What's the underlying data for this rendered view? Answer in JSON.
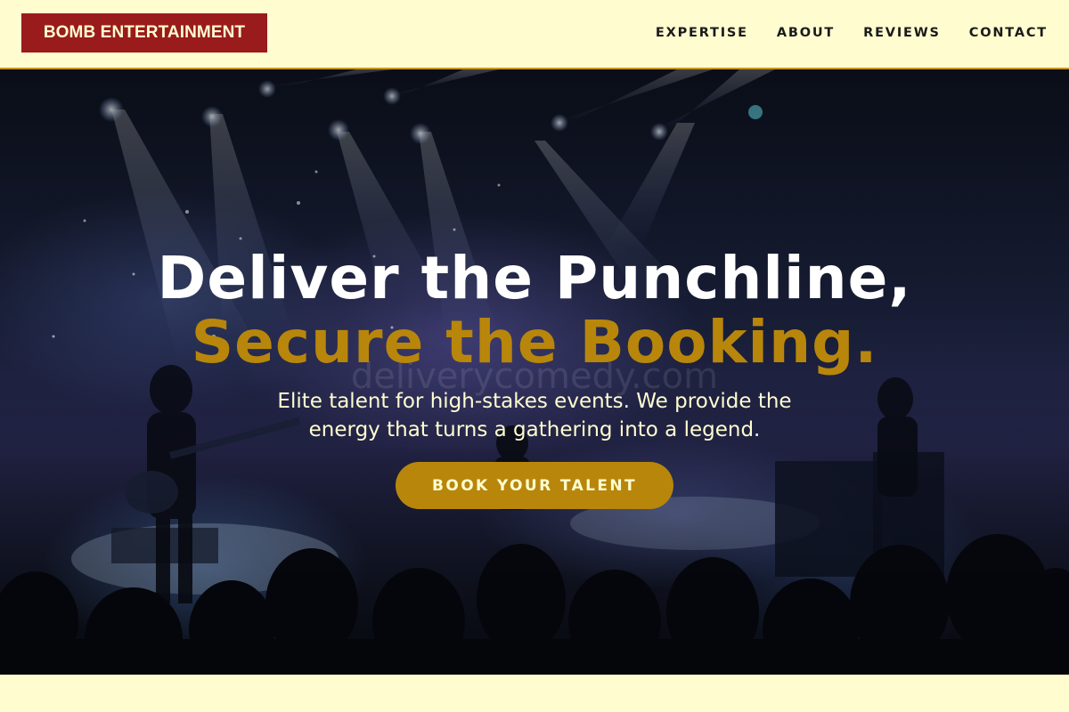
{
  "brand": {
    "name": "BOMB ENTERTAINMENT"
  },
  "nav": {
    "items": [
      {
        "label": "EXPERTISE"
      },
      {
        "label": "ABOUT"
      },
      {
        "label": "REVIEWS"
      },
      {
        "label": "CONTACT"
      }
    ]
  },
  "hero": {
    "headline_line1": "Deliver the Punchline,",
    "headline_line2": "Secure the Booking.",
    "watermark": "deliverycomedy.com",
    "subtitle": "Elite talent for high-stakes events. We provide the energy that turns a gathering into a legend.",
    "cta_label": "BOOK YOUR TALENT",
    "background_image": "concert-stage-photo"
  },
  "colors": {
    "cream": "#fffdd0",
    "brand_red": "#991b1b",
    "gold": "#b8860b",
    "text_dark": "#1a1a1a"
  }
}
